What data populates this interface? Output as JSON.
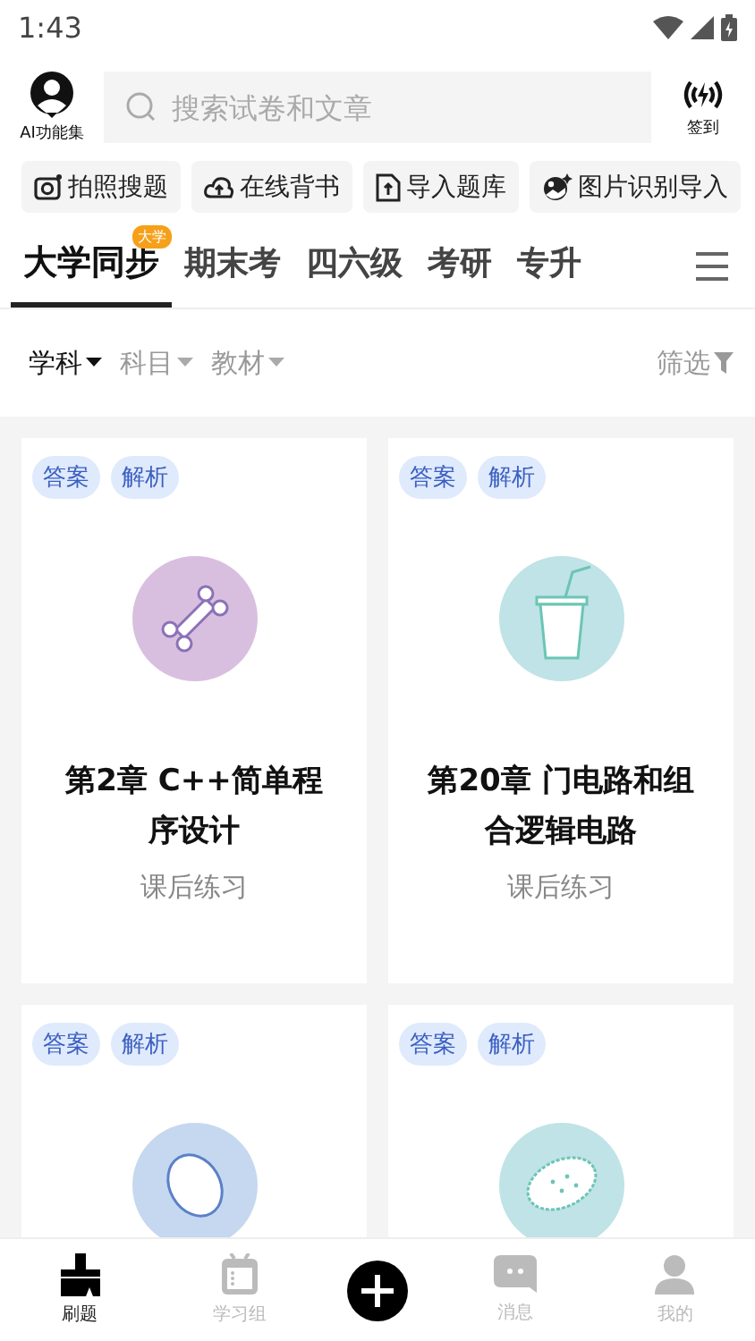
{
  "status_bar": {
    "time": "1:43"
  },
  "header": {
    "ai_label": "AI功能集",
    "search": {
      "placeholder": "搜索试卷和文章"
    },
    "checkin_label": "签到"
  },
  "quick_actions": [
    {
      "label": "拍照搜题"
    },
    {
      "label": "在线背书"
    },
    {
      "label": "导入题库"
    },
    {
      "label": "图片识别导入"
    }
  ],
  "tabs": [
    {
      "label": "大学同步",
      "selected": true,
      "badge": "大学"
    },
    {
      "label": "期末考",
      "selected": false
    },
    {
      "label": "四六级",
      "selected": false
    },
    {
      "label": "考研",
      "selected": false
    },
    {
      "label": "专升",
      "selected": false
    }
  ],
  "filters": [
    {
      "label": "学科",
      "selected": true
    },
    {
      "label": "科目",
      "selected": false
    },
    {
      "label": "教材",
      "selected": false
    }
  ],
  "filter_button": "筛选",
  "cards": [
    {
      "tags": [
        "答案",
        "解析"
      ],
      "color": "#d9bfdf",
      "title": "第2章 C++简单程序设计",
      "subtitle": "课后练习"
    },
    {
      "tags": [
        "答案",
        "解析"
      ],
      "color": "#bfe3e6",
      "title": "第20章 门电路和组合逻辑电路",
      "subtitle": "课后练习"
    },
    {
      "tags": [
        "答案",
        "解析"
      ],
      "color": "#c5d8ef"
    },
    {
      "tags": [
        "答案",
        "解析"
      ],
      "color": "#bfe3e6"
    }
  ],
  "bottom_nav": [
    {
      "kind": "tab",
      "label": "刷题",
      "selected": true
    },
    {
      "kind": "tab",
      "label": "学习组",
      "selected": false
    },
    {
      "kind": "add"
    },
    {
      "kind": "tab",
      "label": "消息",
      "selected": false
    },
    {
      "kind": "tab",
      "label": "我的",
      "selected": false
    }
  ]
}
